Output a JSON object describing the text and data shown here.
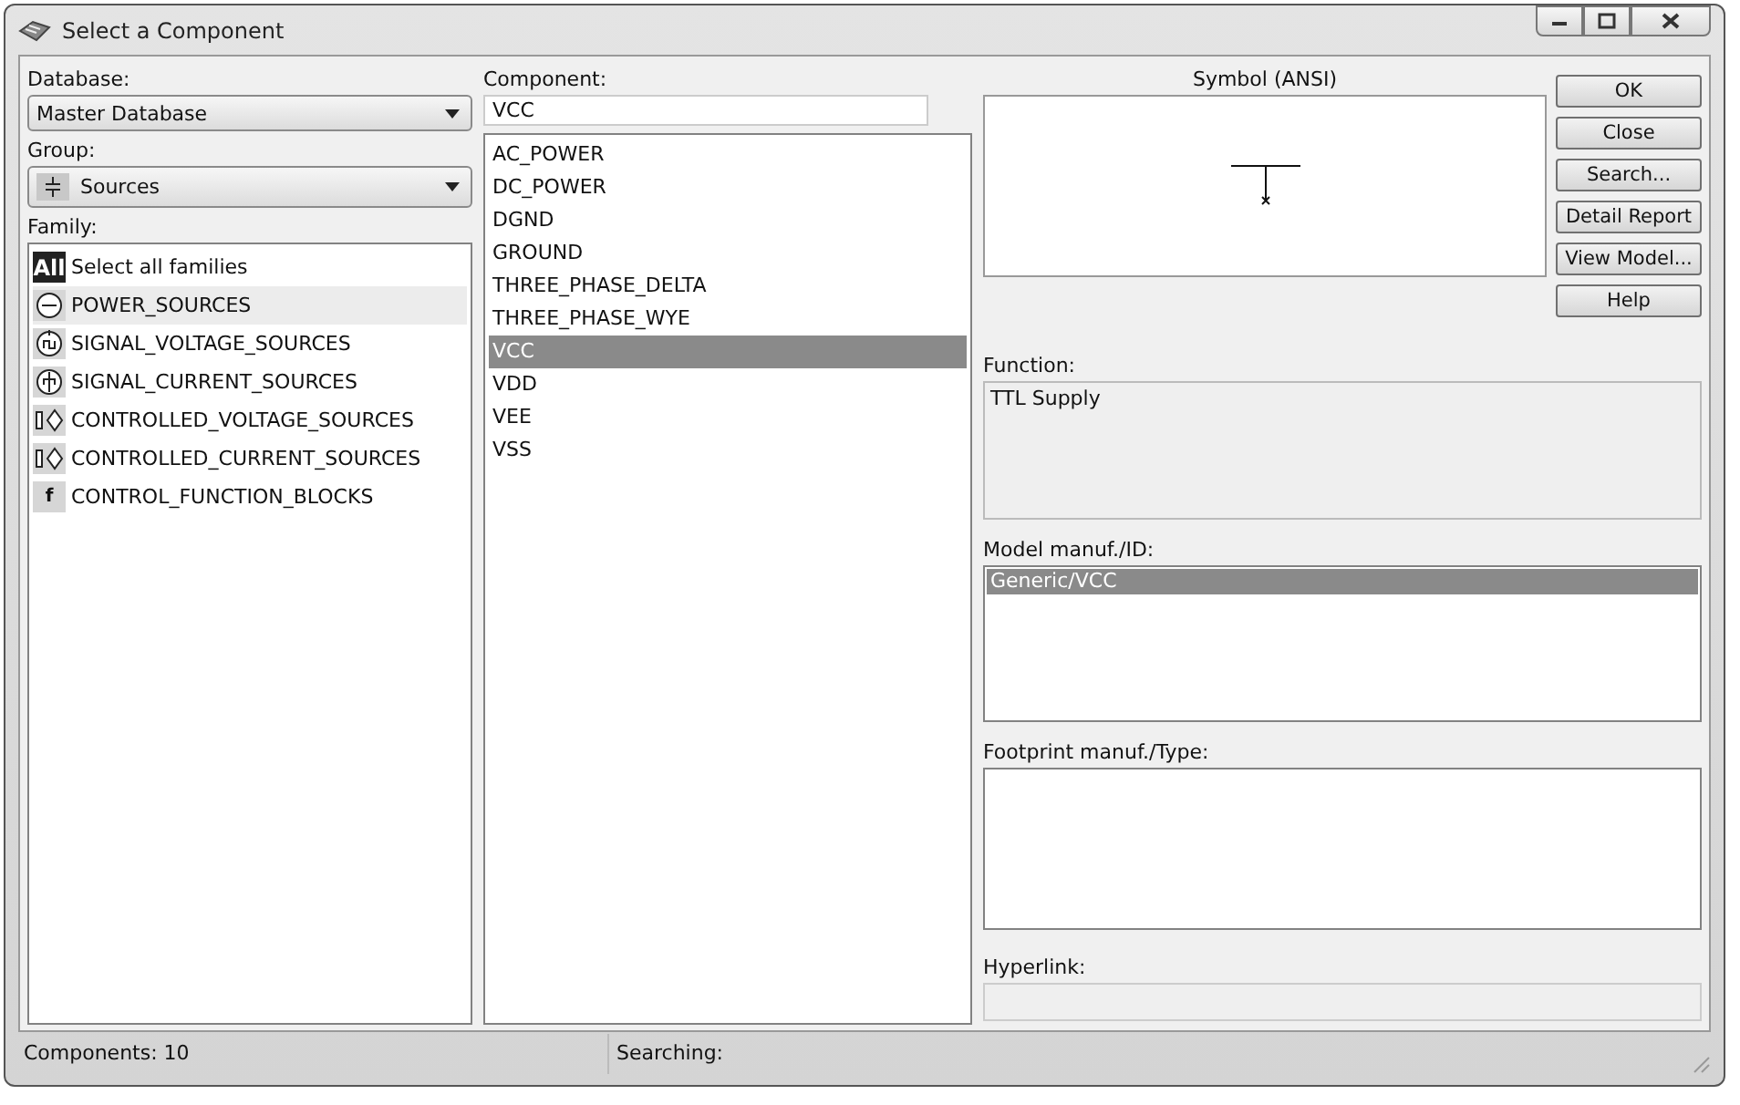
{
  "window": {
    "title": "Select a Component"
  },
  "database": {
    "label": "Database:",
    "value": "Master Database"
  },
  "group": {
    "label": "Group:",
    "value": "Sources"
  },
  "family": {
    "label": "Family:",
    "items": [
      {
        "label": "Select all families",
        "kind": "all",
        "icon_text": "All",
        "selected": false
      },
      {
        "label": "POWER_SOURCES",
        "kind": "power",
        "selected": true
      },
      {
        "label": "SIGNAL_VOLTAGE_SOURCES",
        "kind": "signal_voltage",
        "selected": false
      },
      {
        "label": "SIGNAL_CURRENT_SOURCES",
        "kind": "signal_current",
        "selected": false
      },
      {
        "label": "CONTROLLED_VOLTAGE_SOURCES",
        "kind": "controlled",
        "selected": false
      },
      {
        "label": "CONTROLLED_CURRENT_SOURCES",
        "kind": "controlled",
        "selected": false
      },
      {
        "label": "CONTROL_FUNCTION_BLOCKS",
        "kind": "function",
        "icon_text": "f",
        "selected": false
      }
    ]
  },
  "component": {
    "label": "Component:",
    "value": "VCC",
    "items": [
      {
        "label": "AC_POWER",
        "selected": false
      },
      {
        "label": "DC_POWER",
        "selected": false
      },
      {
        "label": "DGND",
        "selected": false
      },
      {
        "label": "GROUND",
        "selected": false
      },
      {
        "label": "THREE_PHASE_DELTA",
        "selected": false
      },
      {
        "label": "THREE_PHASE_WYE",
        "selected": false
      },
      {
        "label": "VCC",
        "selected": true
      },
      {
        "label": "VDD",
        "selected": false
      },
      {
        "label": "VEE",
        "selected": false
      },
      {
        "label": "VSS",
        "selected": false
      }
    ]
  },
  "symbol": {
    "label": "Symbol (ANSI)"
  },
  "buttons": [
    "OK",
    "Close",
    "Search...",
    "Detail Report",
    "View Model...",
    "Help"
  ],
  "function": {
    "label": "Function:",
    "value": "TTL Supply"
  },
  "model": {
    "label": "Model manuf./ID:",
    "items": [
      {
        "label": "Generic/VCC",
        "selected": true
      }
    ]
  },
  "footprint": {
    "label": "Footprint manuf./Type:"
  },
  "hyperlink": {
    "label": "Hyperlink:"
  },
  "status_bar": {
    "components": "Components: 10",
    "searching": "Searching:"
  }
}
